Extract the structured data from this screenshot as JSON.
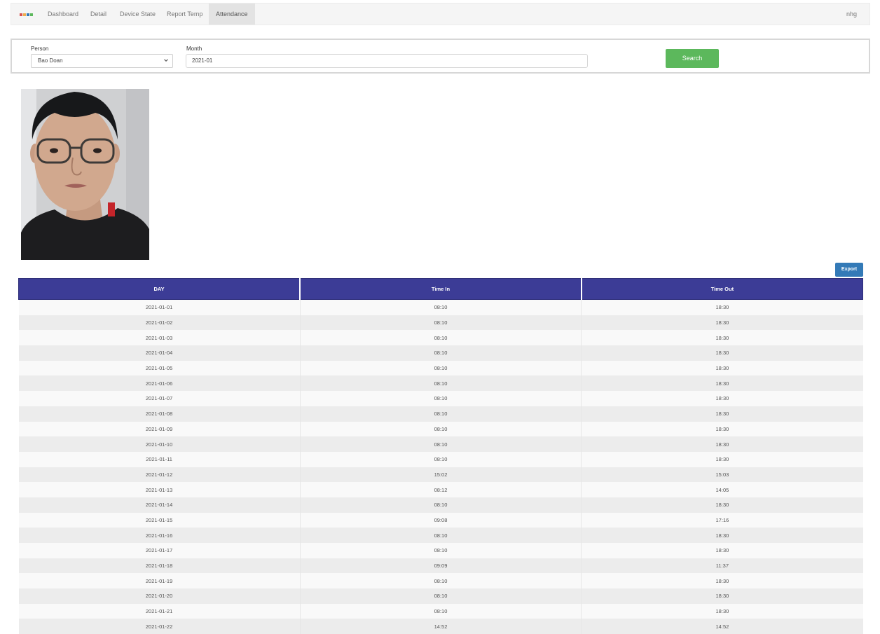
{
  "nav": {
    "logo_colors": [
      "#d9534f",
      "#f0ad4e",
      "#337ab7",
      "#5cb85c"
    ],
    "items": [
      {
        "label": "Dashboard",
        "active": false
      },
      {
        "label": "Detail",
        "active": false
      },
      {
        "label": "Device State",
        "active": false
      },
      {
        "label": "Report Temp",
        "active": false
      },
      {
        "label": "Attendance",
        "active": true
      }
    ],
    "user": "nhg"
  },
  "search": {
    "person_label": "Person",
    "person_value": "Bao Doan",
    "month_label": "Month",
    "month_value": "2021-01",
    "search_button": "Search",
    "search_button_color": "#5cb85c"
  },
  "export_button": "Export",
  "table": {
    "header_color": "#3c3c96",
    "columns": [
      "DAY",
      "Time In",
      "Time Out"
    ],
    "rows": [
      [
        "2021-01-01",
        "08:10",
        "18:30"
      ],
      [
        "2021-01-02",
        "08:10",
        "18:30"
      ],
      [
        "2021-01-03",
        "08:10",
        "18:30"
      ],
      [
        "2021-01-04",
        "08:10",
        "18:30"
      ],
      [
        "2021-01-05",
        "08:10",
        "18:30"
      ],
      [
        "2021-01-06",
        "08:10",
        "18:30"
      ],
      [
        "2021-01-07",
        "08:10",
        "18:30"
      ],
      [
        "2021-01-08",
        "08:10",
        "18:30"
      ],
      [
        "2021-01-09",
        "08:10",
        "18:30"
      ],
      [
        "2021-01-10",
        "08:10",
        "18:30"
      ],
      [
        "2021-01-11",
        "08:10",
        "18:30"
      ],
      [
        "2021-01-12",
        "15:02",
        "15:03"
      ],
      [
        "2021-01-13",
        "08:12",
        "14:05"
      ],
      [
        "2021-01-14",
        "08:10",
        "18:30"
      ],
      [
        "2021-01-15",
        "09:08",
        "17:16"
      ],
      [
        "2021-01-16",
        "08:10",
        "18:30"
      ],
      [
        "2021-01-17",
        "08:10",
        "18:30"
      ],
      [
        "2021-01-18",
        "09:09",
        "11:37"
      ],
      [
        "2021-01-19",
        "08:10",
        "18:30"
      ],
      [
        "2021-01-20",
        "08:10",
        "18:30"
      ],
      [
        "2021-01-21",
        "08:10",
        "18:30"
      ],
      [
        "2021-01-22",
        "14:52",
        "14:52"
      ]
    ]
  }
}
